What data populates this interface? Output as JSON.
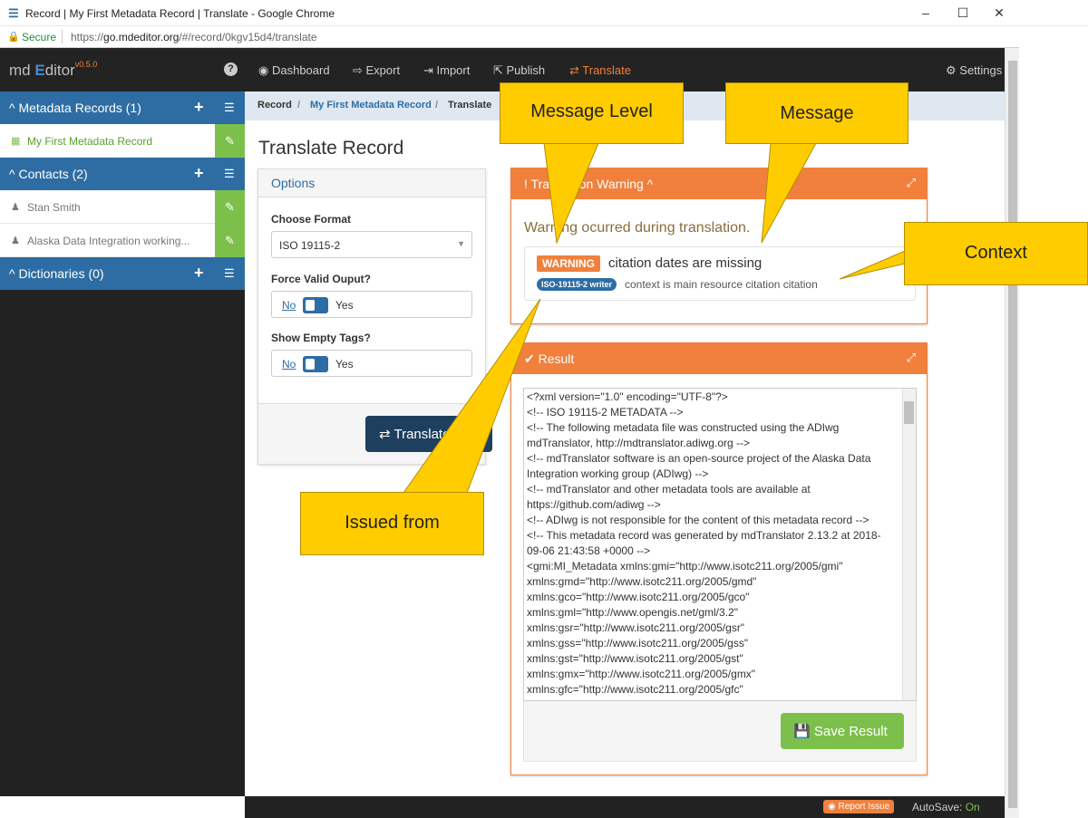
{
  "window": {
    "title": "Record | My First Metadata Record | Translate - Google Chrome",
    "minimize": "–",
    "maximize": "☐",
    "close": "✕"
  },
  "address": {
    "secure_label": "Secure",
    "url_prefix": "https://",
    "url_host": "go.mdeditor.org",
    "url_path": "/#/record/0kgv15d4/translate"
  },
  "app": {
    "logo_md": "md",
    "logo_e": "E",
    "logo_ditor": "ditor",
    "version": "v0.5.0",
    "help": "?"
  },
  "nav": {
    "dashboard": "Dashboard",
    "export": "Export",
    "import": "Import",
    "publish": "Publish",
    "translate": "Translate",
    "settings": "Settings"
  },
  "sidebar": {
    "records_label": "^ Metadata Records (1)",
    "record_item": "My First Metadata Record",
    "contacts_label": "^ Contacts (2)",
    "contact_1": "Stan Smith",
    "contact_2": "Alaska Data Integration working...",
    "dictionaries_label": "^ Dictionaries (0)"
  },
  "breadcrumb": {
    "record": "Record",
    "sep": "/",
    "item": "My First Metadata Record",
    "current": "Translate"
  },
  "page_title": "Translate Record",
  "options": {
    "title": "Options",
    "format_label": "Choose Format",
    "format_value": "ISO 19115-2",
    "force_label": "Force Valid Ouput?",
    "empty_label": "Show Empty Tags?",
    "no": "No",
    "yes": "Yes",
    "translate_btn": "Translate"
  },
  "warning_panel": {
    "title": "Translation Warning ^",
    "intro": "Warning ocurred during translation.",
    "level": "WARNING",
    "message": "citation dates are missing",
    "issuer": "ISO-19115-2 writer",
    "context": "context is main resource citation citation"
  },
  "result_panel": {
    "title": "Result",
    "lines": [
      "<?xml version=\"1.0\" encoding=\"UTF-8\"?>",
      "<!-- ISO 19115-2 METADATA -->",
      "<!-- The following metadata file was constructed using the ADIwg",
      "mdTranslator, http://mdtranslator.adiwg.org -->",
      "<!-- mdTranslator software is an open-source project of the Alaska Data",
      "Integration working group (ADIwg) -->",
      "<!-- mdTranslator and other metadata tools are available at",
      "https://github.com/adiwg -->",
      "<!-- ADIwg is not responsible for the content of this metadata record -->",
      "<!-- This metadata record was generated by mdTranslator 2.13.2 at 2018-",
      "09-06 21:43:58 +0000 -->",
      "<gmi:MI_Metadata xmlns:gmi=\"http://www.isotc211.org/2005/gmi\"",
      "xmlns:gmd=\"http://www.isotc211.org/2005/gmd\"",
      "xmlns:gco=\"http://www.isotc211.org/2005/gco\"",
      "xmlns:gml=\"http://www.opengis.net/gml/3.2\"",
      "xmlns:gsr=\"http://www.isotc211.org/2005/gsr\"",
      "xmlns:gss=\"http://www.isotc211.org/2005/gss\"",
      "xmlns:gst=\"http://www.isotc211.org/2005/gst\"",
      "xmlns:gmx=\"http://www.isotc211.org/2005/gmx\"",
      "xmlns:gfc=\"http://www.isotc211.org/2005/gfc\""
    ],
    "save_btn": "Save Result"
  },
  "status": {
    "report": "Report Issue",
    "autosave_label": "AutoSave:",
    "autosave_value": "On"
  },
  "callouts": {
    "message_level": "Message Level",
    "message": "Message",
    "context": "Context",
    "issued_from": "Issued from"
  },
  "colors": {
    "primary": "#2e6da4",
    "accent": "#f0803c",
    "success": "#7cc04b",
    "callout": "#ffcc00"
  }
}
